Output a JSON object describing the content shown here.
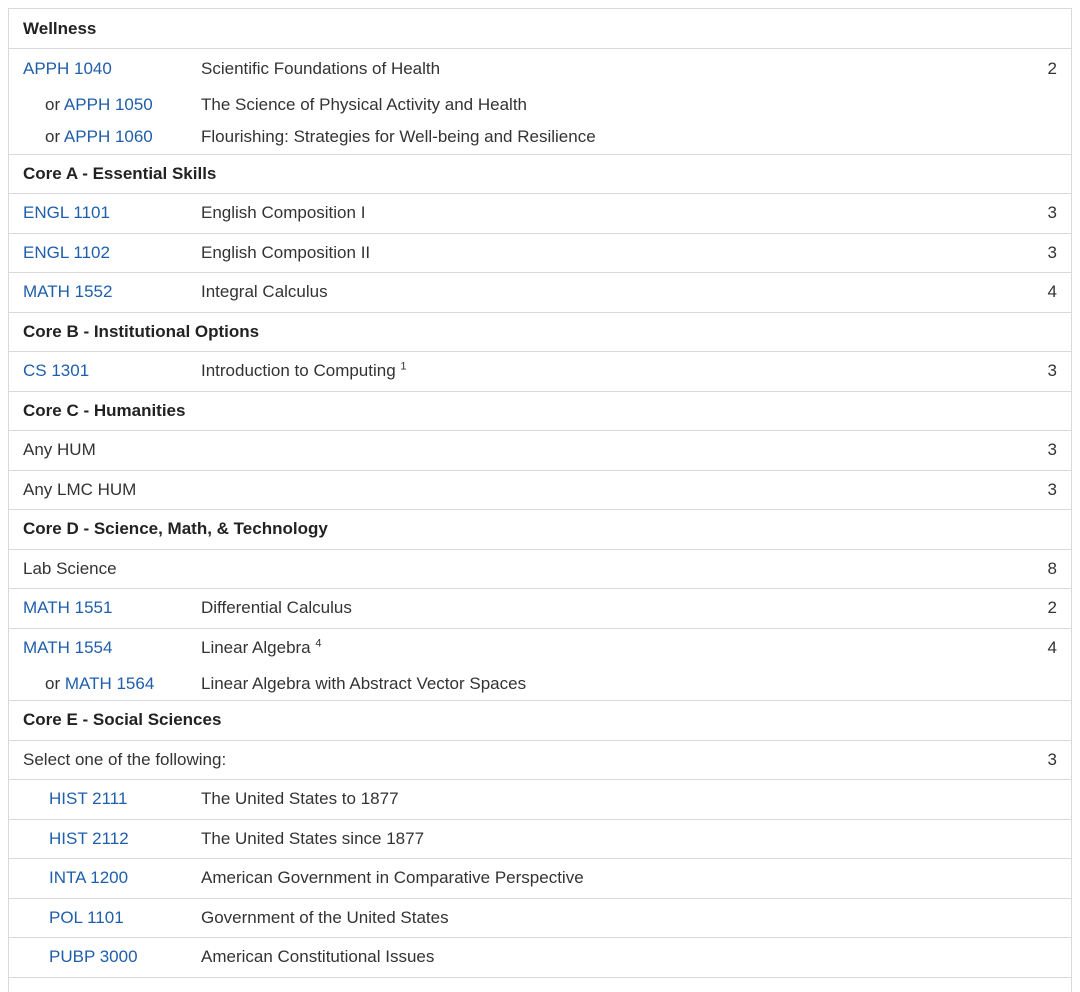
{
  "sections": {
    "wellness": "Wellness",
    "coreA": "Core A - Essential Skills",
    "coreB": "Core B - Institutional Options",
    "coreC": "Core C - Humanities",
    "coreD": "Core D - Science, Math, & Technology",
    "coreE": "Core E - Social Sciences"
  },
  "or_word": "or",
  "rows": {
    "apph1040": {
      "code": "APPH 1040",
      "title": "Scientific Foundations of Health",
      "hours": "2"
    },
    "apph1050": {
      "code": "APPH 1050",
      "title": "The Science of Physical Activity and Health"
    },
    "apph1060": {
      "code": "APPH 1060",
      "title": "Flourishing: Strategies for Well-being and Resilience"
    },
    "engl1101": {
      "code": "ENGL 1101",
      "title": "English Composition I",
      "hours": "3"
    },
    "engl1102": {
      "code": "ENGL 1102",
      "title": "English Composition II",
      "hours": "3"
    },
    "math1552": {
      "code": "MATH 1552",
      "title": "Integral Calculus",
      "hours": "4"
    },
    "cs1301": {
      "code": "CS 1301",
      "title": "Introduction to Computing",
      "footnote": "1",
      "hours": "3"
    },
    "anyhum": {
      "label": "Any HUM",
      "hours": "3"
    },
    "anylmchum": {
      "label": "Any LMC HUM",
      "hours": "3"
    },
    "labsci": {
      "label": "Lab Science",
      "hours": "8"
    },
    "math1551": {
      "code": "MATH 1551",
      "title": "Differential Calculus",
      "hours": "2"
    },
    "math1554": {
      "code": "MATH 1554",
      "title": "Linear Algebra",
      "footnote": "4",
      "hours": "4"
    },
    "math1564": {
      "code": "MATH 1564",
      "title": "Linear Algebra with Abstract Vector Spaces"
    },
    "selectone": {
      "label": "Select one of the following:",
      "hours": "3"
    },
    "hist2111": {
      "code": "HIST 2111",
      "title": "The United States to 1877"
    },
    "hist2112": {
      "code": "HIST 2112",
      "title": "The United States since 1877"
    },
    "inta1200": {
      "code": "INTA 1200",
      "title": "American Government in Comparative Perspective"
    },
    "pol1101": {
      "code": "POL 1101",
      "title": "Government of the United States"
    },
    "pubp3000": {
      "code": "PUBP 3000",
      "title": "American Constitutional Issues"
    }
  },
  "colors": {
    "link": "#1f5eab",
    "border": "#d9d9d9",
    "text": "#222222"
  }
}
